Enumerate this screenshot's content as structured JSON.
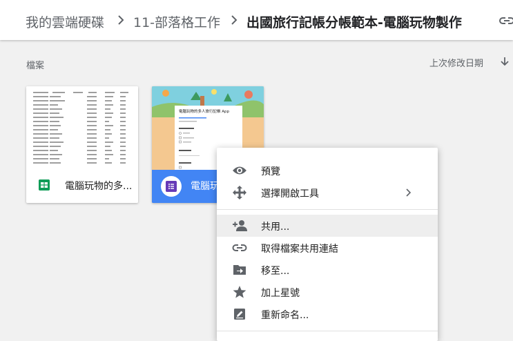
{
  "breadcrumb": {
    "root": "我的雲端硬碟",
    "parent": "11-部落格工作",
    "current": "出國旅行記帳分帳範本-電腦玩物製作"
  },
  "files_section": {
    "label": "檔案",
    "sort_label": "上次修改日期"
  },
  "files": [
    {
      "name": "電腦玩物的多...",
      "type": "sheets",
      "icon": "sheets-icon"
    },
    {
      "name": "電腦玩",
      "type": "forms",
      "icon": "forms-icon",
      "selected": true,
      "thumb_title": "電腦玩物的多人旅行記帳 App"
    }
  ],
  "context_menu": {
    "items": [
      {
        "label": "預覽",
        "icon": "eye-icon"
      },
      {
        "label": "選擇開啟工具",
        "icon": "move-arrows-icon",
        "submenu": true
      },
      {
        "label": "共用...",
        "icon": "add-person-icon",
        "hovered": true
      },
      {
        "label": "取得檔案共用連結",
        "icon": "link-icon"
      },
      {
        "label": "移至...",
        "icon": "move-to-folder-icon"
      },
      {
        "label": "加上星號",
        "icon": "star-icon"
      },
      {
        "label": "重新命名...",
        "icon": "rename-icon"
      }
    ]
  },
  "colors": {
    "sheets_green": "#0f9d58",
    "forms_purple": "#673ab7",
    "selected_blue": "#4285f4",
    "icon_gray": "#5f6368"
  }
}
